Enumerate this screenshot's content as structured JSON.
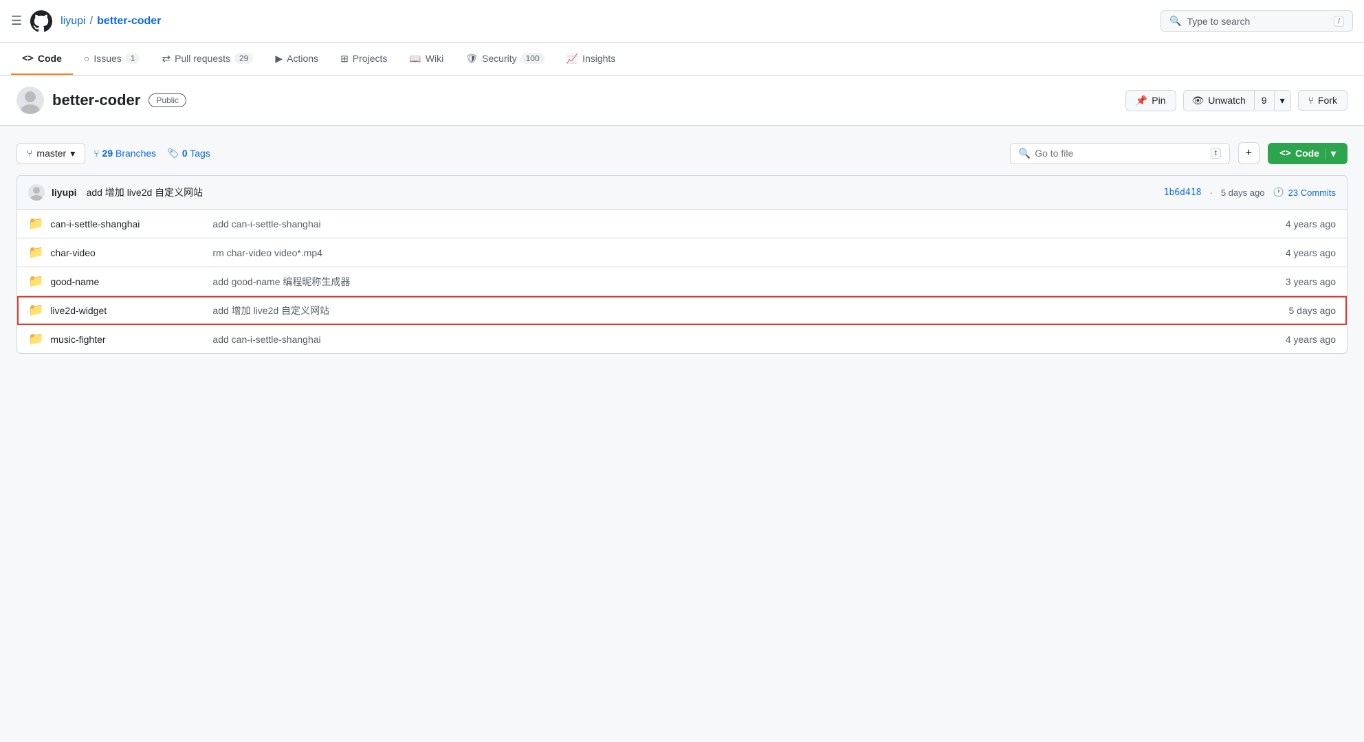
{
  "topNav": {
    "owner": "liyupi",
    "separator": "/",
    "repo": "better-coder",
    "search_placeholder": "Type to search",
    "search_shortcut": "/"
  },
  "repoNav": {
    "tabs": [
      {
        "id": "code",
        "icon": "<>",
        "label": "Code",
        "active": true,
        "badge": null
      },
      {
        "id": "issues",
        "icon": "○",
        "label": "Issues",
        "active": false,
        "badge": "1"
      },
      {
        "id": "pull-requests",
        "icon": "⇄",
        "label": "Pull requests",
        "active": false,
        "badge": "29"
      },
      {
        "id": "actions",
        "icon": "▶",
        "label": "Actions",
        "active": false,
        "badge": null
      },
      {
        "id": "projects",
        "icon": "⊞",
        "label": "Projects",
        "active": false,
        "badge": null
      },
      {
        "id": "wiki",
        "icon": "📖",
        "label": "Wiki",
        "active": false,
        "badge": null
      },
      {
        "id": "security",
        "icon": "🛡",
        "label": "Security",
        "active": false,
        "badge": "100"
      },
      {
        "id": "insights",
        "icon": "📈",
        "label": "Insights",
        "active": false,
        "badge": null
      }
    ]
  },
  "repoHeader": {
    "repo_name": "better-coder",
    "visibility_label": "Public",
    "pin_label": "Pin",
    "unwatch_label": "Unwatch",
    "unwatch_count": "9",
    "fork_label": "Fork"
  },
  "branchBar": {
    "branch_name": "master",
    "branches_count": "29",
    "branches_label": "Branches",
    "tags_count": "0",
    "tags_label": "Tags",
    "goto_placeholder": "Go to file",
    "goto_shortcut": "t",
    "add_label": "+",
    "code_label": "Code"
  },
  "commitRow": {
    "author": "liyupi",
    "message": "add 增加 live2d 自定义网站",
    "hash": "1b6d418",
    "time": "5 days ago",
    "commits_count": "23 Commits",
    "history_icon": "🕐"
  },
  "files": [
    {
      "type": "folder",
      "name": "can-i-settle-shanghai",
      "commit_message": "add can-i-settle-shanghai",
      "time": "4 years ago",
      "selected": false
    },
    {
      "type": "folder",
      "name": "char-video",
      "commit_message": "rm char-video video*.mp4",
      "time": "4 years ago",
      "selected": false
    },
    {
      "type": "folder",
      "name": "good-name",
      "commit_message": "add good-name 编程昵称生成器",
      "time": "3 years ago",
      "selected": false
    },
    {
      "type": "folder",
      "name": "live2d-widget",
      "commit_message": "add 增加 live2d 自定义网站",
      "time": "5 days ago",
      "selected": true
    },
    {
      "type": "folder",
      "name": "music-fighter",
      "commit_message": "add can-i-settle-shanghai",
      "time": "4 years ago",
      "selected": false
    }
  ]
}
